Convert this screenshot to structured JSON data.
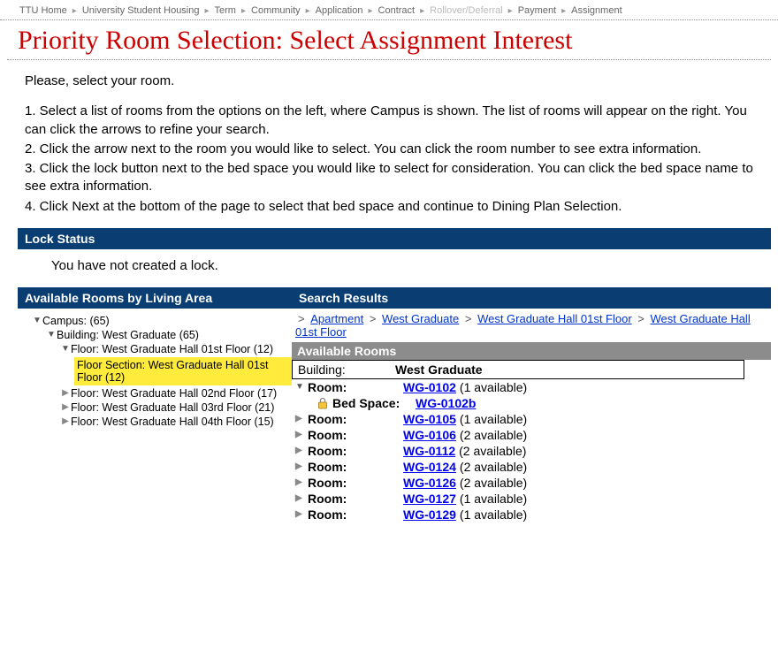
{
  "topCrumbs": [
    {
      "label": "TTU Home",
      "disabled": false
    },
    {
      "label": "University Student Housing",
      "disabled": false
    },
    {
      "label": "Term",
      "disabled": false
    },
    {
      "label": "Community",
      "disabled": false
    },
    {
      "label": "Application",
      "disabled": false
    },
    {
      "label": "Contract",
      "disabled": false
    },
    {
      "label": "Rollover/Deferral",
      "disabled": true
    },
    {
      "label": "Payment",
      "disabled": false
    },
    {
      "label": "Assignment",
      "disabled": false
    }
  ],
  "pageTitle": "Priority Room Selection: Select Assignment Interest",
  "intro": "Please, select your room.",
  "steps": [
    "1. Select a list of rooms from the options on the left, where Campus is shown.  The list of rooms will appear on the right.  You can click the arrows to refine your search.",
    "2. Click the arrow next to the room you would like to select.  You can click the room number to see extra information.",
    "3. Click the lock button next to the bed space you would like to select for consideration.  You can click the bed space name to see extra information.",
    "4. Click Next at the bottom of the page to select that bed space and continue to Dining Plan Selection."
  ],
  "lockHeader": "Lock Status",
  "lockText": "You have not created a lock.",
  "leftHeader": "Available Rooms by Living Area",
  "rightHeader": "Search Results",
  "tree": {
    "campus": "Campus: (65)",
    "building": "Building: West Graduate (65)",
    "floor1": "Floor: West Graduate Hall 01st Floor (12)",
    "section": "Floor Section: West Graduate Hall 01st Floor (12)",
    "floor2": "Floor: West Graduate Hall 02nd Floor (17)",
    "floor3": "Floor: West Graduate Hall 03rd Floor (21)",
    "floor4": "Floor: West Graduate Hall 04th Floor (15)"
  },
  "resultCrumbs": [
    "Apartment",
    "West Graduate",
    "West Graduate Hall 01st Floor",
    "West Graduate Hall 01st Floor"
  ],
  "availHeader": "Available Rooms",
  "buildingLabel": "Building:",
  "buildingValue": "West Graduate",
  "roomLabel": "Room:",
  "bedLabel": "Bed Space:",
  "rooms": [
    {
      "code": "WG-0102",
      "avail": "(1 available)",
      "expanded": true,
      "bed": "WG-0102b"
    },
    {
      "code": "WG-0105",
      "avail": "(1 available)",
      "expanded": false
    },
    {
      "code": "WG-0106",
      "avail": "(2 available)",
      "expanded": false
    },
    {
      "code": "WG-0112",
      "avail": "(2 available)",
      "expanded": false
    },
    {
      "code": "WG-0124",
      "avail": "(2 available)",
      "expanded": false
    },
    {
      "code": "WG-0126",
      "avail": "(2 available)",
      "expanded": false
    },
    {
      "code": "WG-0127",
      "avail": "(1 available)",
      "expanded": false
    },
    {
      "code": "WG-0129",
      "avail": "(1 available)",
      "expanded": false
    }
  ]
}
